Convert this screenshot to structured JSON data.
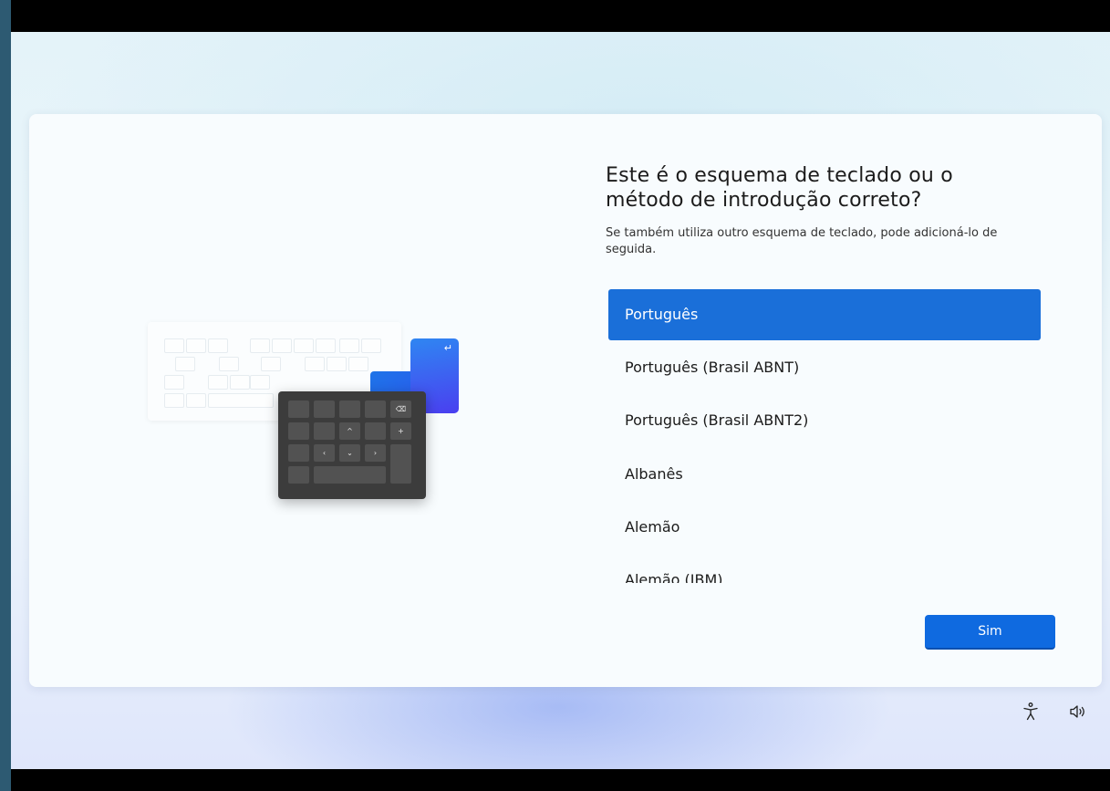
{
  "setup": {
    "title": "Este é o esquema de teclado ou o método de introdução correto?",
    "subtitle": "Se também utiliza outro esquema de teclado, pode adicioná-lo de seguida.",
    "options": [
      {
        "label": "Português",
        "selected": true
      },
      {
        "label": "Português (Brasil ABNT)",
        "selected": false
      },
      {
        "label": "Português (Brasil ABNT2)",
        "selected": false
      },
      {
        "label": "Albanês",
        "selected": false
      },
      {
        "label": "Alemão",
        "selected": false
      },
      {
        "label": "Alemão (IBM)",
        "selected": false
      }
    ],
    "confirm_label": "Sim"
  },
  "illustration": {
    "numpad_keys": [
      "⌫",
      "^",
      "+",
      "‹",
      "⌄",
      "›"
    ],
    "enter_key": "↵"
  },
  "tray": {
    "icons": [
      "accessibility-icon",
      "volume-icon"
    ]
  },
  "colors": {
    "accent": "#1a6fd9",
    "button": "#0f6ae0",
    "card": "#f8fcfe"
  }
}
